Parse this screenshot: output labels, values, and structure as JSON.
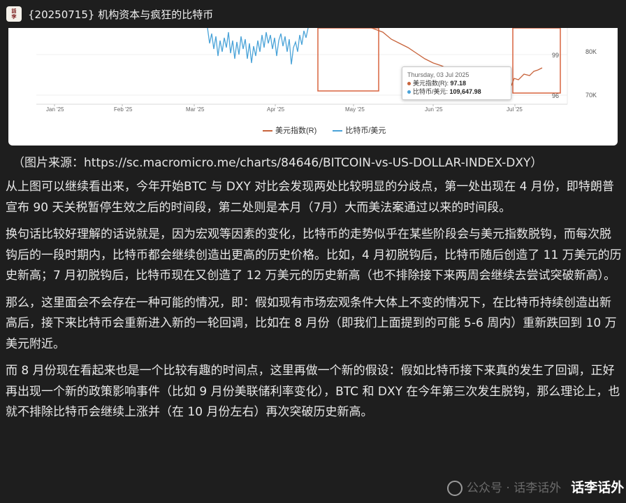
{
  "window": {
    "title": "{20250715} 机构资本与疯狂的比特币",
    "app_icon_text": "话李话外"
  },
  "chart_data": {
    "type": "line",
    "x_ticks": [
      "Jan '25",
      "Feb '25",
      "Mar '25",
      "Apr '25",
      "May '25",
      "Jun '25",
      "Jul '25"
    ],
    "right_axis_dxy_ticks": [
      "99",
      "96"
    ],
    "right_axis_btc_ticks": [
      "80K",
      "70K"
    ],
    "series": [
      {
        "name": "美元指数(R)",
        "color": "#c8643c"
      },
      {
        "name": "比特币/美元",
        "color": "#4aa3d8"
      }
    ],
    "tooltip": {
      "date": "Thursday, 03 Jul 2025",
      "rows": [
        {
          "label": "美元指数(R):",
          "value": "97.18",
          "color": "#c8643c"
        },
        {
          "label": "比特币/美元:",
          "value": "109,647.98",
          "color": "#4aa3d8"
        }
      ]
    }
  },
  "source": {
    "prefix": "（图片来源：",
    "link": "https://sc.macromicro.me/charts/84646/BITCOIN-vs-US-DOLLAR-INDEX-DXY",
    "suffix": "）"
  },
  "paragraphs": [
    "从上图可以继续看出来，今年开始BTC 与 DXY 对比会发现两处比较明显的分歧点，第一处出现在 4 月份，即特朗普宣布 90 天关税暂停生效之后的时间段，第二处则是本月（7月）大而美法案通过以来的时间段。",
    "换句话比较好理解的话说就是，因为宏观等因素的变化，比特币的走势似乎在某些阶段会与美元指数脱钩，而每次脱钩后的一段时期内，比特币都会继续创造出更高的历史价格。比如，4 月初脱钩后，比特币随后创造了 11 万美元的历史新高；7 月初脱钩后，比特币现在又创造了 12 万美元的历史新高（也不排除接下来两周会继续去尝试突破新高）。",
    "那么，这里面会不会存在一种可能的情况，即：假如现有市场宏观条件大体上不变的情况下，在比特币持续创造出新高后，接下来比特币会重新进入新的一轮回调，比如在 8 月份（即我们上面提到的可能 5-6 周内）重新跌回到 10 万美元附近。",
    "而 8 月份现在看起来也是一个比较有趣的时间点，这里再做一个新的假设：假如比特币接下来真的发生了回调，正好再出现一个新的政策影响事件（比如 9 月份美联储利率变化），BTC 和 DXY 在今年第三次发生脱钩，那么理论上，也就不排除比特币会继续上涨并（在 10 月份左右）再次突破历史新高。"
  ],
  "watermark": {
    "faint": "公众号 · 话李话外",
    "name": "话李话外"
  }
}
